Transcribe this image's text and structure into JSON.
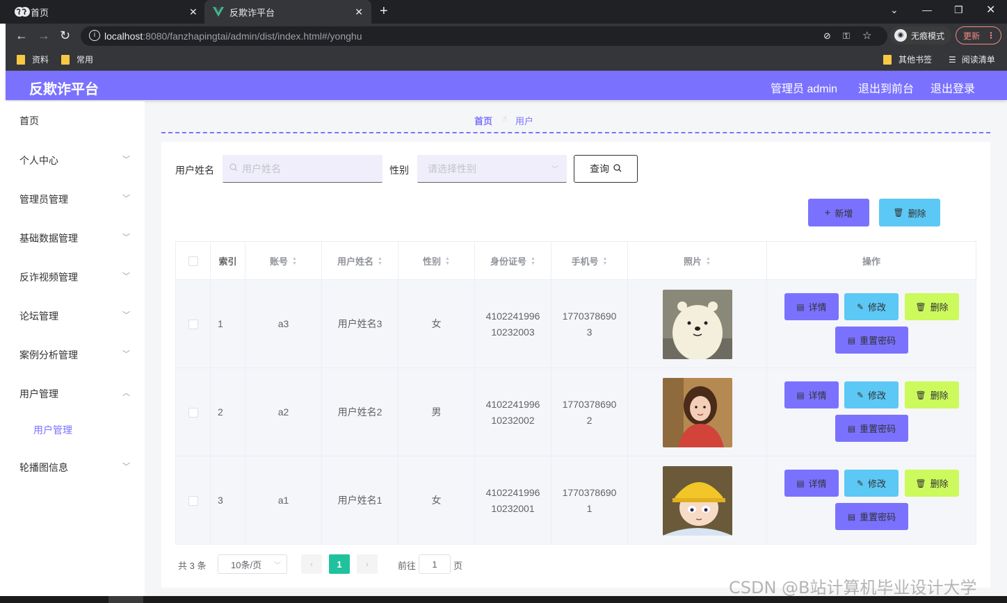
{
  "browser": {
    "tabs": [
      {
        "title": "首页",
        "active": false
      },
      {
        "title": "反欺诈平台",
        "active": true
      }
    ],
    "url_host": "localhost",
    "url_rest": ":8080/fanzhapingtai/admin/dist/index.html#/yonghu",
    "incognito_label": "无痕模式",
    "update_label": "更新",
    "bookmarks": [
      "资料",
      "常用",
      "其他书签",
      "阅读清单"
    ]
  },
  "header": {
    "brand": "反欺诈平台",
    "admin_label": "管理员 admin",
    "front_link": "退出到前台",
    "logout_link": "退出登录",
    "accent_color": "#7a72ff"
  },
  "sidebar": {
    "items": [
      {
        "label": "首页",
        "has_children": false
      },
      {
        "label": "个人中心",
        "has_children": true
      },
      {
        "label": "管理员管理",
        "has_children": true
      },
      {
        "label": "基础数据管理",
        "has_children": true
      },
      {
        "label": "反诈视频管理",
        "has_children": true
      },
      {
        "label": "论坛管理",
        "has_children": true
      },
      {
        "label": "案例分析管理",
        "has_children": true
      },
      {
        "label": "用户管理",
        "has_children": true,
        "expanded": true
      },
      {
        "label": "用户管理",
        "sub": true,
        "active": true
      },
      {
        "label": "轮播图信息",
        "has_children": true
      }
    ]
  },
  "breadcrumb": {
    "home": "首页",
    "current": "用户"
  },
  "search": {
    "name_label": "用户姓名",
    "name_placeholder": "用户姓名",
    "gender_label": "性别",
    "gender_placeholder": "请选择性别",
    "query_button": "查询"
  },
  "actions": {
    "add_button": "新增",
    "delete_button": "删除"
  },
  "table": {
    "columns": [
      "索引",
      "账号",
      "用户姓名",
      "性别",
      "身份证号",
      "手机号",
      "照片",
      "操作"
    ],
    "rows": [
      {
        "index": "1",
        "account": "a3",
        "name": "用户姓名3",
        "gender": "女",
        "id_line1": "4102241996",
        "id_line2": "10232003",
        "phone_line1": "1770378690",
        "phone_line2": "3",
        "photo": "polar-bear-cartoon"
      },
      {
        "index": "2",
        "account": "a2",
        "name": "用户姓名2",
        "gender": "男",
        "id_line1": "4102241996",
        "id_line2": "10232002",
        "phone_line1": "1770378690",
        "phone_line2": "2",
        "photo": "girl-portrait"
      },
      {
        "index": "3",
        "account": "a1",
        "name": "用户姓名1",
        "gender": "女",
        "id_line1": "4102241996",
        "id_line2": "10232001",
        "phone_line1": "1770378690",
        "phone_line2": "1",
        "photo": "anime-boy-yellow-hat"
      }
    ],
    "row_actions": {
      "detail": "详情",
      "edit": "修改",
      "delete": "删除",
      "reset": "重置密码"
    }
  },
  "pagination": {
    "total_text": "共 3 条",
    "page_size": "10条/页",
    "current_page": "1",
    "goto_label": "前往",
    "goto_value": "1",
    "goto_unit": "页"
  },
  "watermark": "CSDN @B站计算机毕业设计大学"
}
